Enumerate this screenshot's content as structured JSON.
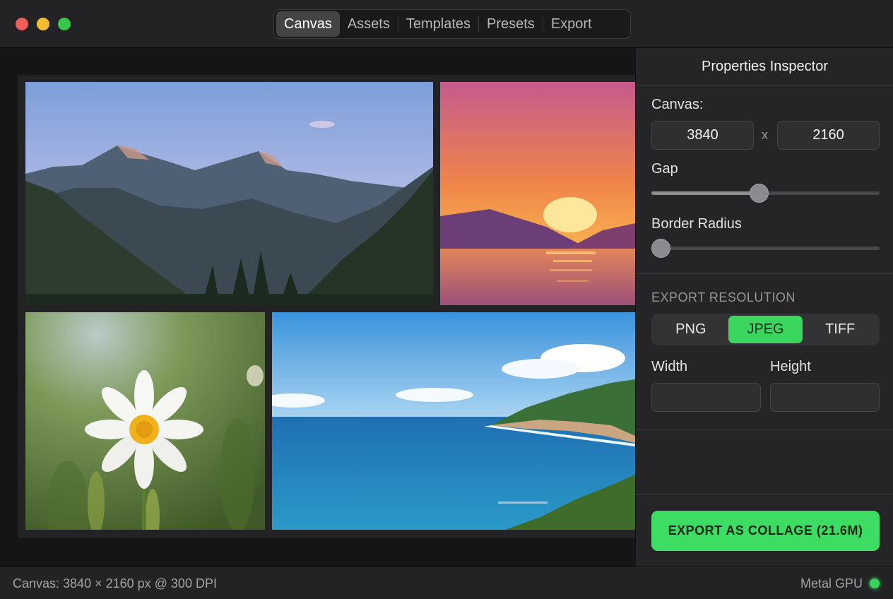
{
  "tabs": [
    "Canvas",
    "Assets",
    "Templates",
    "Presets",
    "Export"
  ],
  "active_tab": "Canvas",
  "inspector": {
    "title": "Properties Inspector",
    "canvas_label": "Canvas:",
    "canvas_width": "3840",
    "canvas_height": "2160",
    "size_separator": "x",
    "gap_label": "Gap",
    "gap_value": 0.47,
    "border_radius_label": "Border Radius",
    "border_radius_value": 0.0,
    "export_section": "EXPORT RESOLUTION",
    "formats": [
      "PNG",
      "JPEG",
      "TIFF"
    ],
    "selected_format": "JPEG",
    "width_label": "Width",
    "height_label": "Height",
    "width_value": "",
    "height_value": "",
    "export_button": "EXPORT AS COLLAGE (21.6M)"
  },
  "status": {
    "left": "Canvas: 3840 × 2160 px @ 300 DPI",
    "right": "Metal GPU"
  },
  "colors": {
    "accent": "#3ddc62",
    "gpu_status": "#36d55a"
  }
}
